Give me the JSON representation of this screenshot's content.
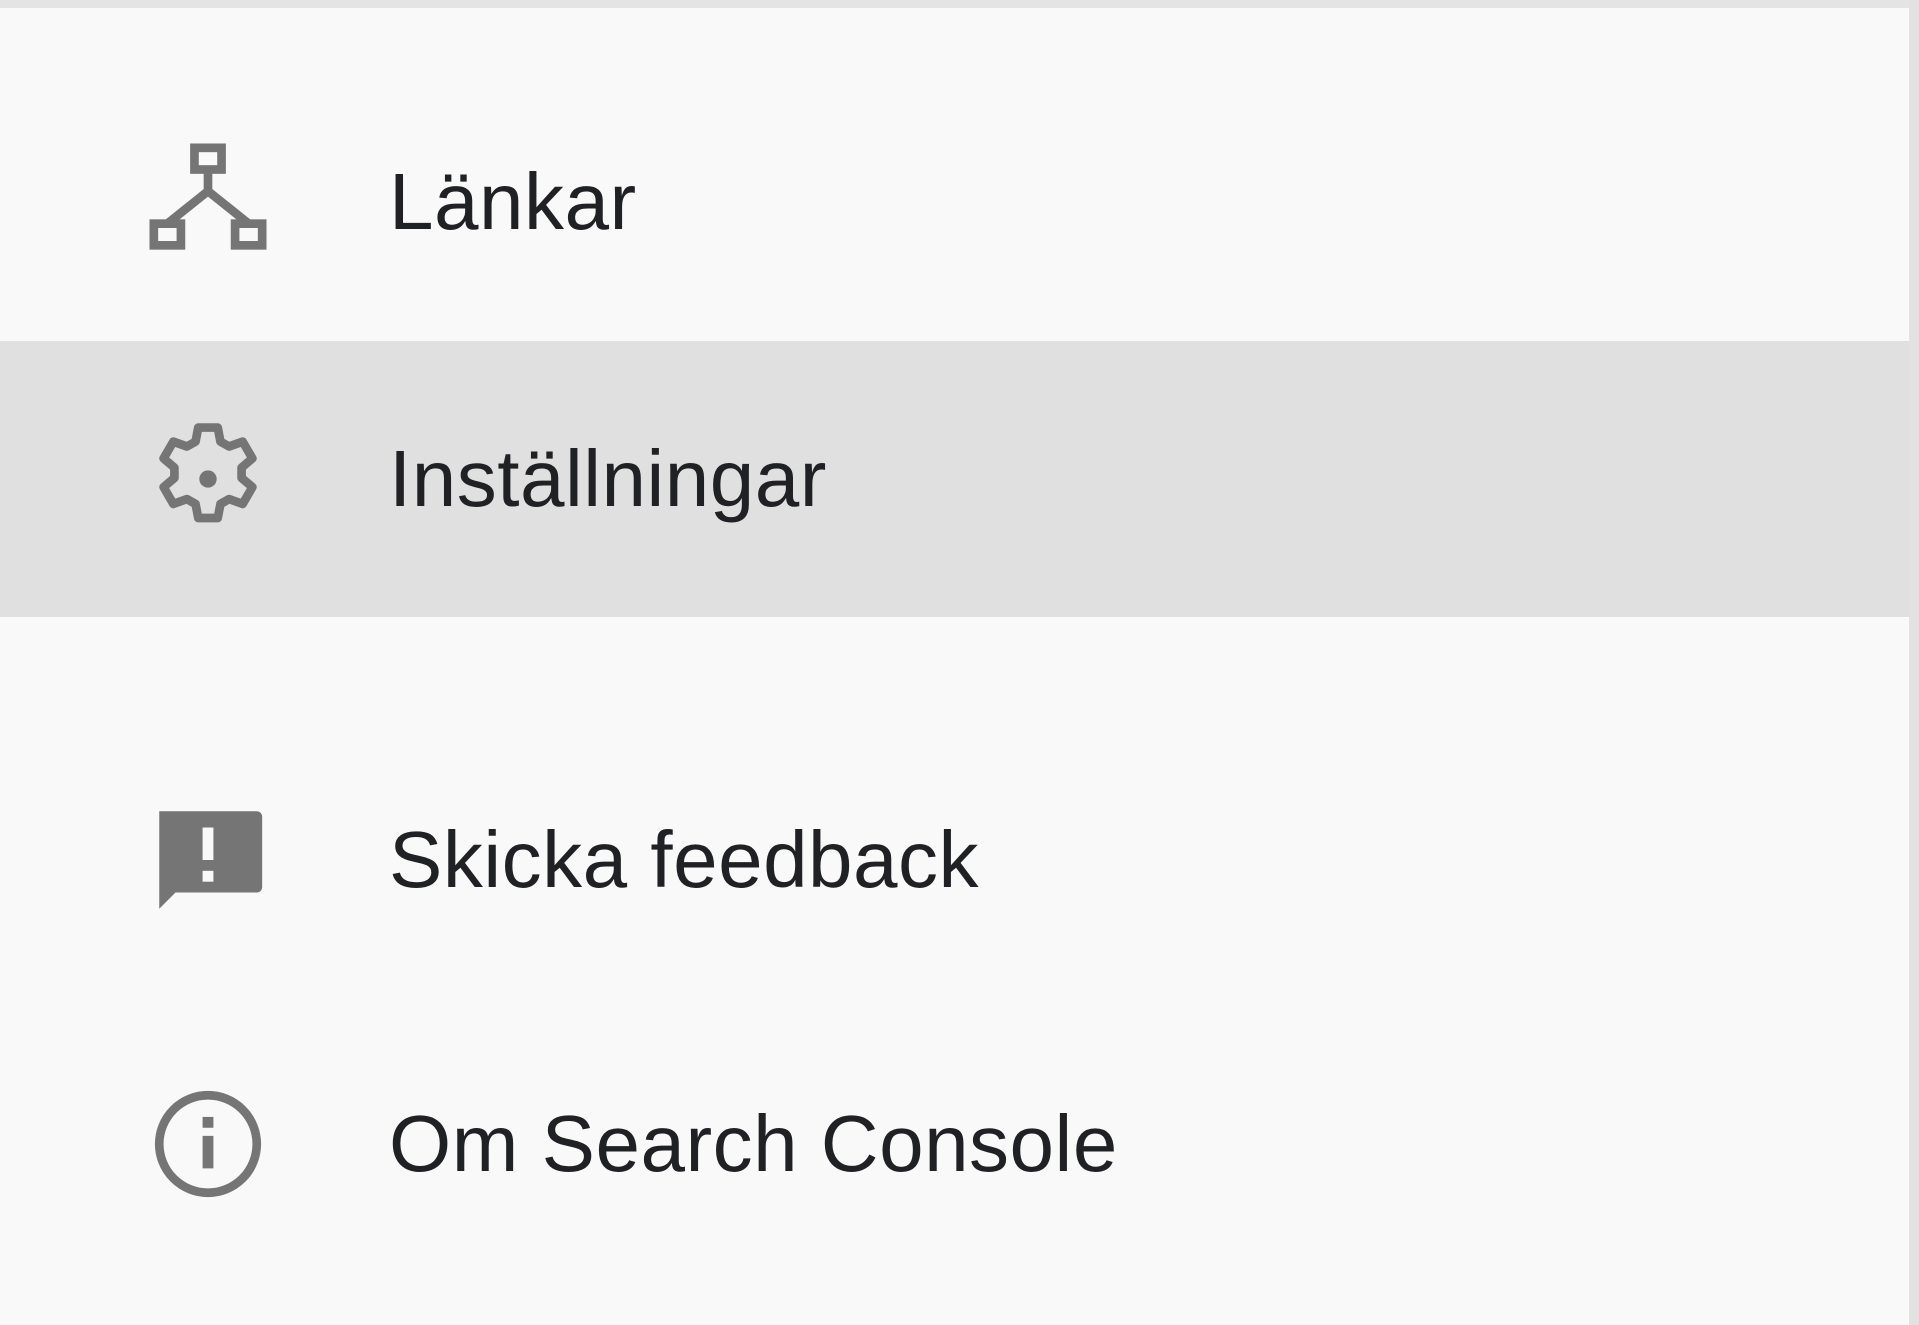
{
  "nav": {
    "items": [
      {
        "label": "Länkar",
        "icon": "sitemap-icon",
        "active": false
      },
      {
        "label": "Inställningar",
        "icon": "gear-icon",
        "active": true
      },
      {
        "label": "Skicka feedback",
        "icon": "feedback-icon",
        "active": false
      },
      {
        "label": "Om Search Console",
        "icon": "info-icon",
        "active": false
      }
    ]
  },
  "colors": {
    "background": "#f9f9f9",
    "active_row": "#e0e0e0",
    "icon": "#757575",
    "text": "#202124"
  }
}
